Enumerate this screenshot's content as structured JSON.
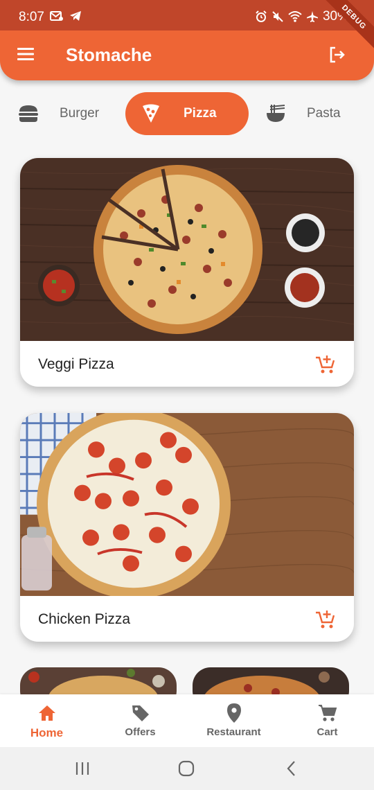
{
  "status_bar": {
    "time": "8:07",
    "battery": "30%",
    "debug_label": "DEBUG",
    "left_icons": [
      "image-mail-icon",
      "telegram-icon"
    ],
    "right_icons": [
      "alarm-icon",
      "mute-icon",
      "wifi-icon",
      "airplane-icon"
    ]
  },
  "app_bar": {
    "title": "Stomache",
    "menu_icon": "menu-icon",
    "logout_icon": "logout-icon"
  },
  "categories": [
    {
      "label": "Burger",
      "icon": "burger-icon",
      "selected": false
    },
    {
      "label": "Pizza",
      "icon": "pizza-icon",
      "selected": true
    },
    {
      "label": "Pasta",
      "icon": "noodle-bowl-icon",
      "selected": false
    }
  ],
  "items": [
    {
      "name": "Veggi Pizza",
      "action_icon": "add-to-cart-icon"
    },
    {
      "name": "Chicken Pizza",
      "action_icon": "add-to-cart-icon"
    }
  ],
  "bottom_nav": [
    {
      "label": "Home",
      "icon": "home-icon",
      "active": true
    },
    {
      "label": "Offers",
      "icon": "tag-icon",
      "active": false
    },
    {
      "label": "Restaurant",
      "icon": "location-pin-icon",
      "active": false
    },
    {
      "label": "Cart",
      "icon": "cart-icon",
      "active": false
    }
  ],
  "colors": {
    "accent": "#ee6535",
    "status_bar": "#c0462a",
    "background": "#f6f6f6",
    "inactive_text": "#666666"
  }
}
